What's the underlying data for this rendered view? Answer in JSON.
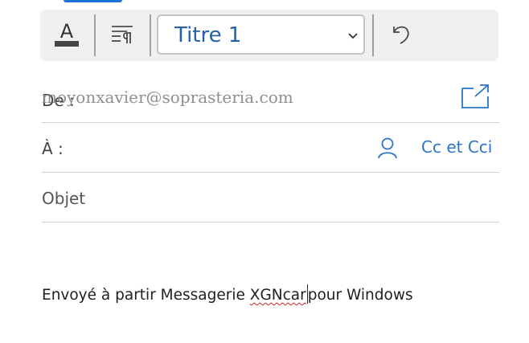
{
  "toolbar": {
    "font_color_icon": "font-color-icon",
    "paragraph_icon": "paragraph-format-icon",
    "style_select": {
      "selected": "Titre 1"
    },
    "undo_icon": "undo-icon"
  },
  "compose": {
    "from": {
      "label": "De :",
      "value": "moyonxavier@soprasteria.com",
      "popout_icon": "popout-icon"
    },
    "to": {
      "label": "À :",
      "value": "",
      "contacts_icon": "person-icon",
      "cc_label": "Cc et Cci"
    },
    "subject": {
      "placeholder": "Objet",
      "value": ""
    },
    "body": {
      "before": "Envoyé à partir Messagerie ",
      "misspelled": "XGNcar",
      "after": "pour Windows"
    }
  },
  "colors": {
    "accent": "#2c74c8",
    "select_text": "#2660a8",
    "toolbar_bg": "#f0f0f0",
    "misspelling": "#d02020"
  }
}
